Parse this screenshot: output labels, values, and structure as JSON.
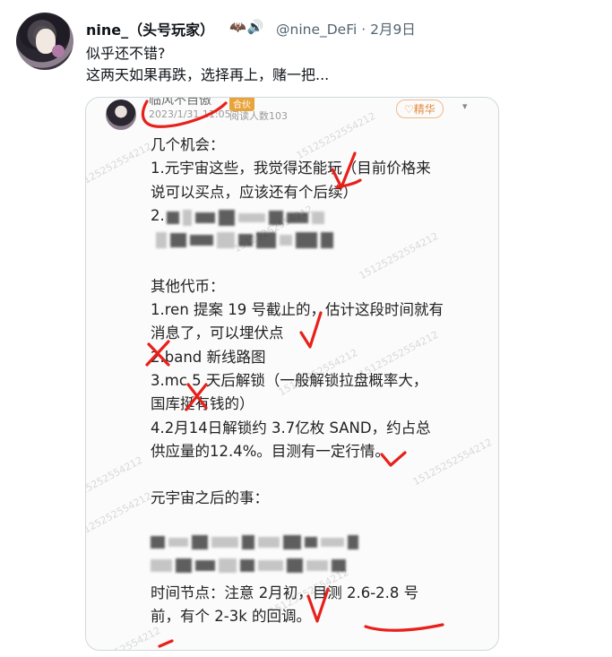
{
  "tweet": {
    "author_name": "nine_（头号玩家）",
    "badges": "🦇🔊",
    "handle": "@nine_DeFi · 2月9日",
    "text_line1": "似乎还不错?",
    "text_line2": "这两天如果再跌，选择再上，赌一把..."
  },
  "card": {
    "poster_name": "临风不自傲",
    "poster_tag": "合伙",
    "post_date": "2023/1/31 11:05",
    "readers": "阅读人数103",
    "essence_label": "♡精华",
    "chevron": "▾",
    "watermark": "15125252554212",
    "lines": [
      "几个机会：",
      "1.元宇宙这些，我觉得还能玩（目前价格来",
      "说可以买点，应该还有个后续）",
      "2.",
      "",
      "",
      "其他代币：",
      "1.ren 提案 19 号截止的，估计这段时间就有",
      "消息了，可以埋伏点",
      "2.band 新线路图",
      "3.mc 5 天后解锁（一般解锁拉盘概率大，",
      "国库挺有钱的）",
      "4.2月14日解锁约 3.7亿枚 SAND，约占总",
      "供应量的12.4%。目测有一定行情。",
      "",
      "元宇宙之后的事：",
      "",
      "",
      "",
      "时间节点：注意 2月初，目测 2.6-2.8 号",
      "前，有个 2-3k 的回调。"
    ]
  },
  "colors": {
    "ink_red": "#e8201a",
    "handle_gray": "#536471",
    "border": "#cfd9de"
  }
}
